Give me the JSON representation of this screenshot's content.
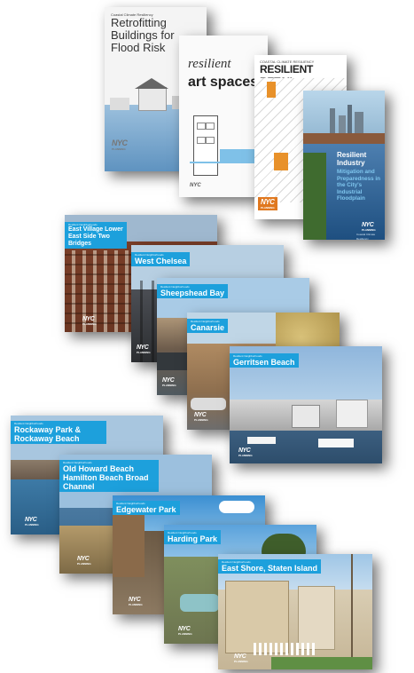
{
  "covers_top": {
    "retrofit": {
      "kicker": "Coastal Climate Resiliency",
      "title": "Retrofitting Buildings for Flood Risk",
      "logo": "NYC",
      "logo_sub": "PLANNING"
    },
    "art": {
      "word1": "resilient",
      "word2": "art spaces",
      "logo": "NYC"
    },
    "retail": {
      "kicker": "COASTAL CLIMATE RESILIENCY",
      "title": "RESILIENT RETAIL",
      "logo": "NYC",
      "logo_sub": "PLANNING"
    },
    "industry": {
      "title": "Resilient Industry",
      "subtitle": "Mitigation and Preparedness in the City's Industrial Floodplain",
      "logo": "NYC",
      "logo_sub": "PLANNING",
      "footer": "Coastal Climate Resiliency"
    }
  },
  "covers_mid": [
    {
      "title": "East Village Lower East Side Two Bridges",
      "kicker": "Resilient Neighborhoods"
    },
    {
      "title": "West Chelsea",
      "kicker": "Resilient Neighborhoods"
    },
    {
      "title": "Sheepshead Bay",
      "kicker": "Resilient Neighborhoods"
    },
    {
      "title": "Canarsie",
      "kicker": "Resilient Neighborhoods"
    },
    {
      "title": "Gerritsen Beach",
      "kicker": "Resilient Neighborhoods"
    }
  ],
  "covers_bottom": [
    {
      "title": "Rockaway Park & Rockaway Beach",
      "kicker": "Resilient Neighborhoods"
    },
    {
      "title": "Old Howard Beach Hamilton Beach Broad Channel",
      "kicker": "Resilient Neighborhoods"
    },
    {
      "title": "Edgewater Park",
      "kicker": "Resilient Neighborhoods"
    },
    {
      "title": "Harding Park",
      "kicker": "Resilient Neighborhoods"
    },
    {
      "title": "East Shore, Staten Island",
      "kicker": "Resilient Neighborhoods"
    }
  ],
  "logo": {
    "main": "NYC",
    "sub": "PLANNING"
  },
  "colors": {
    "caption_blue": "#1da0dc"
  }
}
